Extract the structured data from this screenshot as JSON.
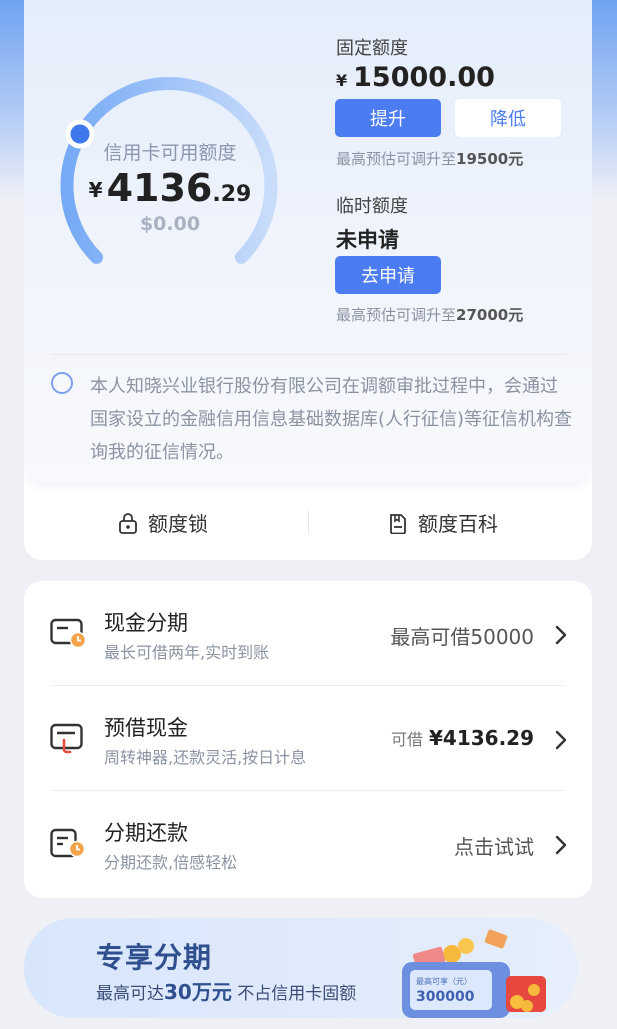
{
  "credit": {
    "gauge_label": "信用卡可用额度",
    "currency": "¥",
    "available_int": "4136",
    "available_dec": ".29",
    "secondary": "$0.00",
    "usage_fraction": 0.0
  },
  "fixed_limit": {
    "label": "固定额度",
    "currency": "¥",
    "amount": "15000.00",
    "increase_label": "提升",
    "decrease_label": "降低",
    "hint_prefix": "最高预估可调升至",
    "hint_value": "19500元"
  },
  "temp_limit": {
    "label": "临时额度",
    "status": "未申请",
    "apply_label": "去申请",
    "hint_prefix": "最高预估可调升至",
    "hint_value": "27000元"
  },
  "consent": {
    "text": "本人知晓兴业银行股份有限公司在调额审批过程中，会通过国家设立的金融信用信息基础数据库(人行征信)等征信机构查询我的征信情况。"
  },
  "tools": [
    {
      "label": "额度锁",
      "icon": "lock-icon"
    },
    {
      "label": "额度百科",
      "icon": "encyclopedia-icon"
    }
  ],
  "services": [
    {
      "title": "现金分期",
      "subtitle": "最长可借两年,实时到账",
      "right_prefix": "",
      "right_value": "最高可借50000",
      "icon": "cash-installment-icon"
    },
    {
      "title": "预借现金",
      "subtitle": "周转神器,还款灵活,按日计息",
      "right_prefix": "可借",
      "right_value": "¥4136.29",
      "icon": "cash-advance-icon"
    },
    {
      "title": "分期还款",
      "subtitle": "分期还款,倍感轻松",
      "right_prefix": "",
      "right_value": "点击试试",
      "icon": "installment-repay-icon"
    }
  ],
  "banner": {
    "title": "专享分期",
    "sub_prefix": "最高可达",
    "sub_highlight": "30万元",
    "sub_suffix": " 不占信用卡固额",
    "card_label": "最高可享（元）",
    "card_amount": "300000"
  },
  "colors": {
    "accent": "#4b7cf2",
    "gauge_start": "#7fb1f7",
    "gauge_end": "#d4e3fb",
    "banner_text": "#2f4f8f"
  }
}
